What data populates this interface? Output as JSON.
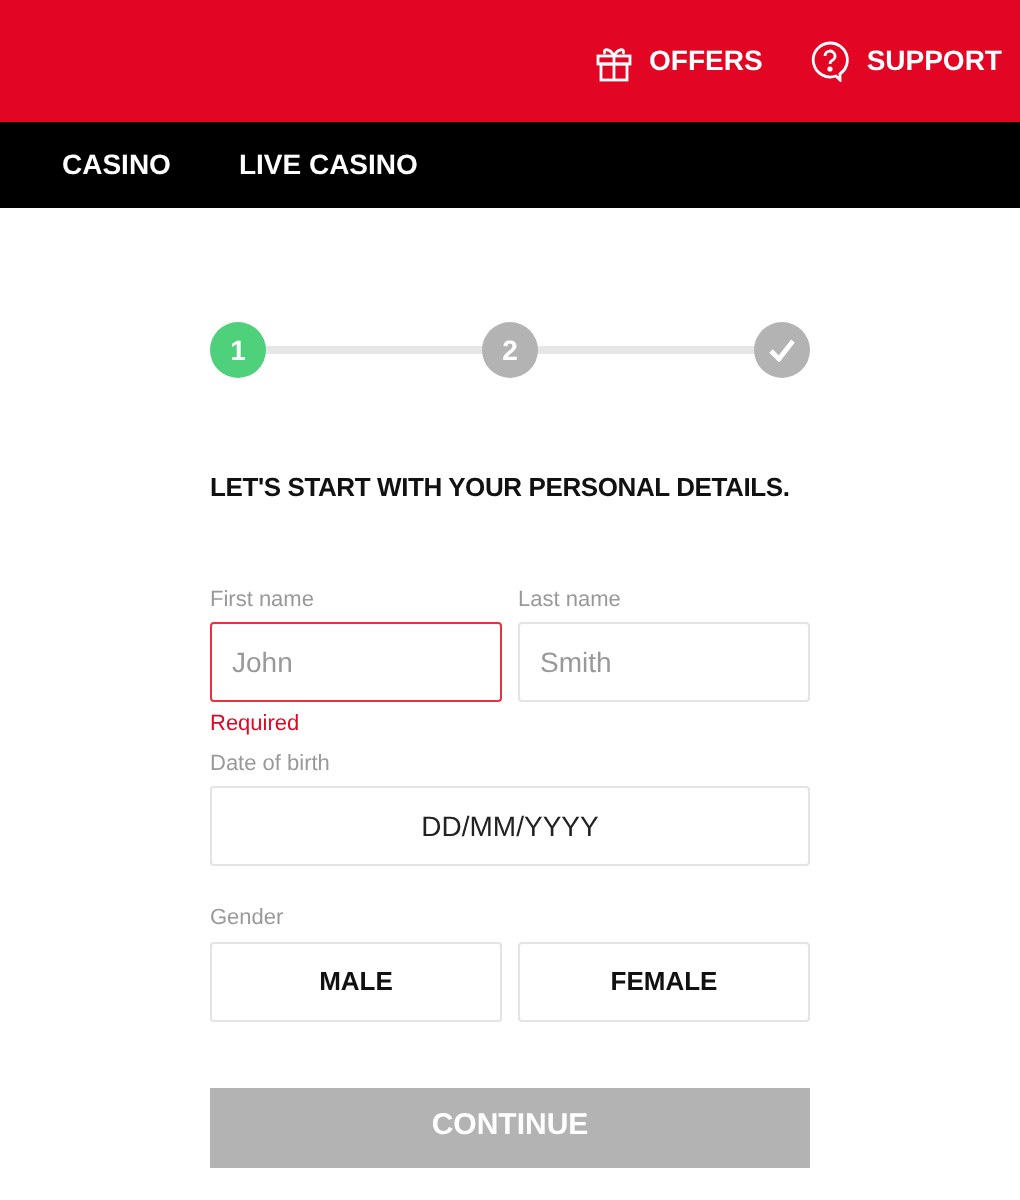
{
  "header": {
    "links": [
      {
        "kind": "gift",
        "label": "OFFERS"
      },
      {
        "kind": "help",
        "label": "SUPPORT"
      }
    ]
  },
  "nav": {
    "items": [
      {
        "label": "CASINO"
      },
      {
        "label": "LIVE CASINO"
      }
    ]
  },
  "steps": [
    {
      "kind": "number",
      "label": "1",
      "selected": true
    },
    {
      "kind": "number",
      "label": "2",
      "selected": false
    },
    {
      "kind": "check",
      "selected": false
    }
  ],
  "heading": "LET'S START WITH YOUR PERSONAL DETAILS.",
  "name_fields": [
    {
      "label": "First name",
      "placeholder": "John",
      "error": "Required"
    },
    {
      "label": "Last name",
      "placeholder": "Smith"
    }
  ],
  "dob": {
    "label": "Date of birth",
    "placeholder": "DD/MM/YYYY"
  },
  "gender": {
    "label": "Gender",
    "options": [
      {
        "label": "MALE",
        "selected": false
      },
      {
        "label": "FEMALE",
        "selected": false
      }
    ]
  },
  "continue_button": {
    "label": "CONTINUE",
    "disabled": true
  }
}
